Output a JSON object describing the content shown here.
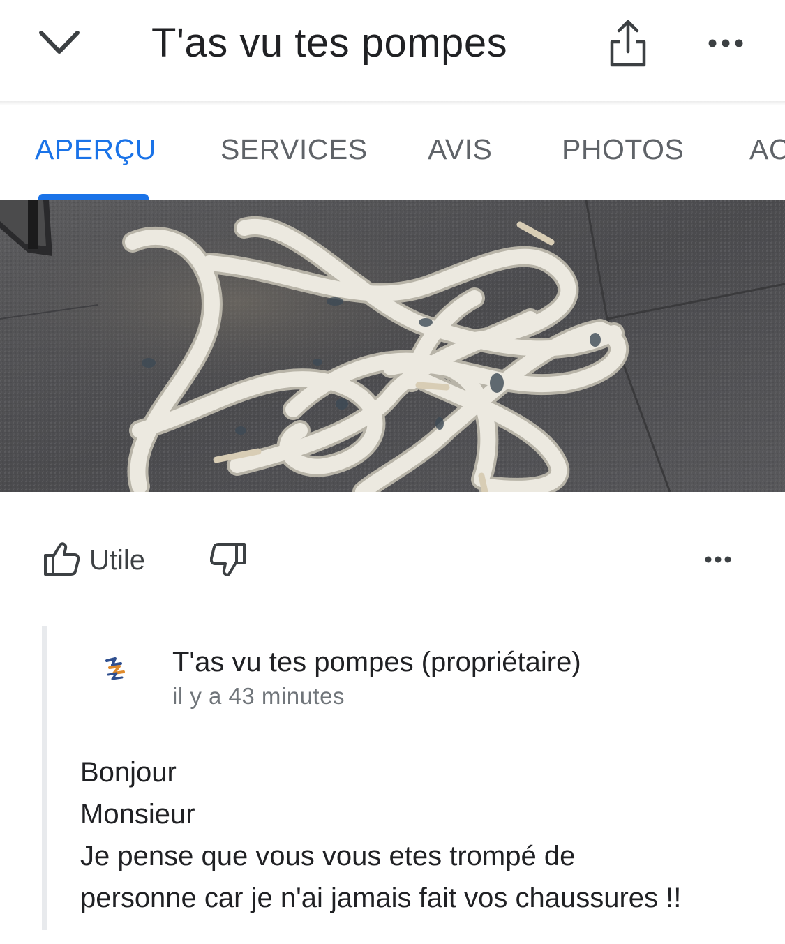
{
  "header": {
    "title": "T'as vu tes pompes",
    "back_icon": "chevron-down-icon",
    "share_icon": "share-icon",
    "more_icon": "more-horizontal-icon"
  },
  "tabs": [
    {
      "label": "APERÇU",
      "active": true
    },
    {
      "label": "SERVICES",
      "active": false
    },
    {
      "label": "AVIS",
      "active": false
    },
    {
      "label": "PHOTOS",
      "active": false
    },
    {
      "label": "AC",
      "active": false
    }
  ],
  "colors": {
    "accent": "#1a73e8",
    "tab_inactive": "#5f6368",
    "meta_text": "#70757a"
  },
  "review_actions": {
    "helpful_label": "Utile",
    "helpful_icon": "thumbs-up-icon",
    "not_helpful_icon": "thumbs-down-icon",
    "more_icon": "more-horizontal-icon"
  },
  "owner_reply": {
    "name": "T'as vu tes pompes (propriétaire)",
    "time": "il y a 43 minutes",
    "lines": [
      "Bonjour",
      "Monsieur",
      "Je pense que vous vous etes trompé de",
      "personne car je n'ai jamais fait vos chaussures !!"
    ]
  }
}
